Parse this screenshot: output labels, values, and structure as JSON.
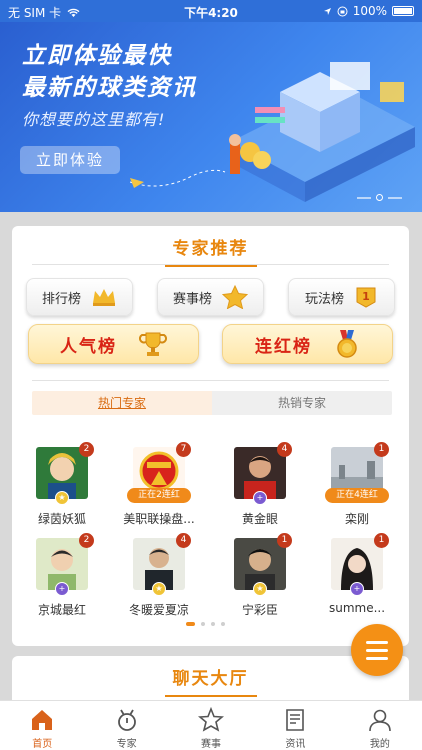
{
  "status_bar": {
    "carrier": "无 SIM 卡",
    "time": "下午4:20",
    "battery": "100%"
  },
  "banner": {
    "title_line1": "立即体验最快",
    "title_line2": "最新的球类资讯",
    "subtitle": "你想要的这里都有!",
    "cta_label": "立即体验"
  },
  "expert_section": {
    "title": "专家推荐",
    "rank_buttons": [
      {
        "label": "排行榜",
        "icon": "crown-icon"
      },
      {
        "label": "赛事榜",
        "icon": "star-icon"
      },
      {
        "label": "玩法榜",
        "icon": "medal-number-icon"
      }
    ],
    "big_buttons": [
      {
        "label": "人气榜",
        "icon": "trophy-icon"
      },
      {
        "label": "连红榜",
        "icon": "gold-medal-icon"
      }
    ],
    "tabs": [
      {
        "label": "热门专家",
        "active": true
      },
      {
        "label": "热销专家",
        "active": false
      }
    ],
    "experts": [
      {
        "name": "绿茵妖狐",
        "badge": "2",
        "streak": ""
      },
      {
        "name": "美职联操盘...",
        "badge": "7",
        "streak": "正在2连红"
      },
      {
        "name": "黄金眼",
        "badge": "4",
        "streak": ""
      },
      {
        "name": "栾刚",
        "badge": "1",
        "streak": "正在4连红"
      },
      {
        "name": "京城最红",
        "badge": "2",
        "streak": ""
      },
      {
        "name": "冬暖爱夏凉",
        "badge": "4",
        "streak": ""
      },
      {
        "name": "宁彩臣",
        "badge": "1",
        "streak": ""
      },
      {
        "name": "summe...",
        "badge": "1",
        "streak": ""
      }
    ]
  },
  "chat_section": {
    "title": "聊天大厅"
  },
  "tabbar": [
    {
      "label": "首页",
      "icon": "home-icon",
      "active": true
    },
    {
      "label": "专家",
      "icon": "expert-icon",
      "active": false
    },
    {
      "label": "赛事",
      "icon": "star-outline-icon",
      "active": false
    },
    {
      "label": "资讯",
      "icon": "news-icon",
      "active": false
    },
    {
      "label": "我的",
      "icon": "user-icon",
      "active": false
    }
  ],
  "colors": {
    "accent": "#e8870f",
    "banner_blue": "#2f6fd8",
    "red_text": "#d92415"
  }
}
